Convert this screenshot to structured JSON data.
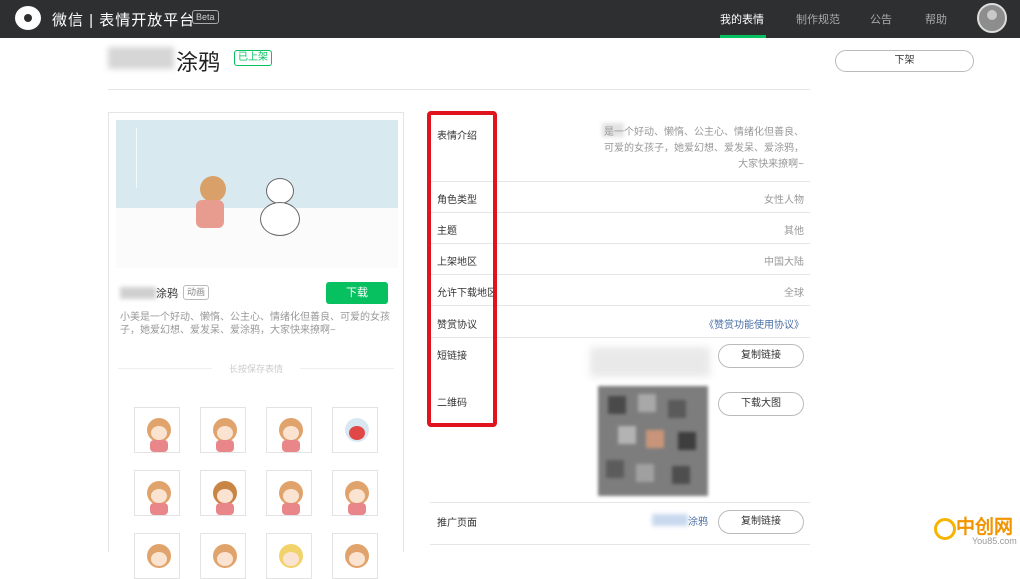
{
  "header": {
    "brand": "微信 | 表情开放平台",
    "beta_badge": "Beta",
    "nav": [
      {
        "label": "我的表情",
        "active": true
      },
      {
        "label": "制作规范",
        "active": false
      },
      {
        "label": "公告",
        "active": false
      },
      {
        "label": "帮助",
        "active": false
      }
    ]
  },
  "page": {
    "title": "涂鸦",
    "status": "已上架",
    "delist_button": "下架"
  },
  "preview": {
    "name": "涂鸦",
    "type_badge": "动画",
    "download_button": "下载",
    "description": "小美是一个好动、懒惰、公主心、情绪化但善良、可爱的女孩子，她爱幻想、爱发呆、爱涂鸦，大家快来撩啊~",
    "sticker_section_label": "长按保存表情"
  },
  "details": [
    {
      "label": "表情介绍",
      "value": "是一个好动、懒惰、公主心、情绪化但善良、可爱的女孩子，她爱幻想、爱发呆、爱涂鸦，大家快来撩啊~"
    },
    {
      "label": "角色类型",
      "value": "女性人物"
    },
    {
      "label": "主题",
      "value": "其他"
    },
    {
      "label": "上架地区",
      "value": "中国大陆"
    },
    {
      "label": "允许下载地区",
      "value": "全球"
    },
    {
      "label": "赞赏协议",
      "value": "《赞赏功能使用协议》"
    },
    {
      "label": "短链接",
      "button": "复制链接"
    },
    {
      "label": "二维码",
      "button": "下载大图"
    },
    {
      "label": "推广页面",
      "value": "涂鸦",
      "button": "复制链接"
    }
  ],
  "watermark": {
    "text": "中创网",
    "sub": "You85.com"
  },
  "colors": {
    "topbar": "#2d2f31",
    "accent_green": "#07c160",
    "highlight_red": "#e0141e",
    "link_blue": "#4a6fa5"
  }
}
